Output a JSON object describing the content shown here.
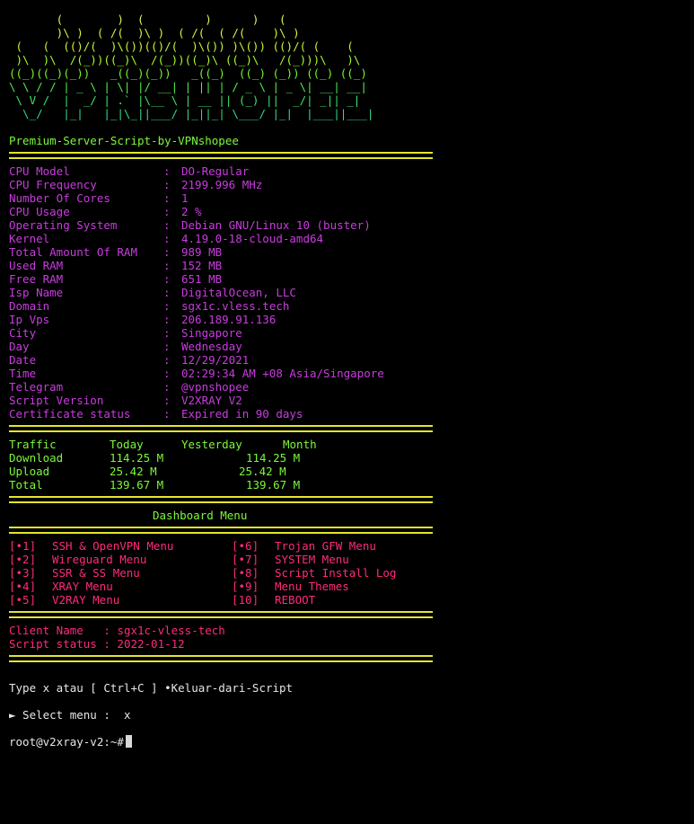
{
  "banner": {
    "ascii_lines": [
      "       (        )  (         )      )   (",
      "       )\\ )  ( /(  )\\ )  ( /(  ( /(    )\\ )",
      " (   (  (()/(  )\\())(()/(  )\\()) )\\()) (()/( (    (",
      " )\\  )\\  /(_))((_)\\  /(_))((_)\\ ((_)\\   /(_)))\\   )\\",
      "((_)((_)(_))   _((_)(_))   _((_)  ((_) (_)) ((_) ((_)",
      "\\ \\ / / | _ \\ | \\| |/ __| | || | / _ \\ | _ \\| __| __|",
      " \\ V /  |  _/ | .` |\\__ \\ | __ || (_) ||  _/| _|| _|",
      "  \\_/   |_|   |_|\\_||___/ |_||_| \\___/ |_|  |___||___|"
    ],
    "title": "Premium-Server-Script-by-VPNshopee"
  },
  "sysinfo": [
    {
      "label": "CPU Model",
      "value": "DO-Regular"
    },
    {
      "label": "CPU Frequency",
      "value": "2199.996 MHz"
    },
    {
      "label": "Number Of Cores",
      "value": "1"
    },
    {
      "label": "CPU Usage",
      "value": "2 %"
    },
    {
      "label": "Operating System",
      "value": "Debian GNU/Linux 10 (buster)"
    },
    {
      "label": "Kernel",
      "value": "4.19.0-18-cloud-amd64"
    },
    {
      "label": "Total Amount Of RAM",
      "value": "989 MB"
    },
    {
      "label": "Used RAM",
      "value": "152 MB"
    },
    {
      "label": "Free RAM",
      "value": "651 MB"
    },
    {
      "label": "Isp Name",
      "value": "DigitalOcean, LLC"
    },
    {
      "label": "Domain",
      "value": "sgx1c.vless.tech"
    },
    {
      "label": "Ip Vps",
      "value": "206.189.91.136"
    },
    {
      "label": "City",
      "value": "Singapore"
    },
    {
      "label": "Day",
      "value": "Wednesday"
    },
    {
      "label": "Date",
      "value": "12/29/2021"
    },
    {
      "label": "Time",
      "value": "02:29:34 AM +08 Asia/Singapore"
    },
    {
      "label": "Telegram",
      "value": "@vpnshopee"
    },
    {
      "label": "Script Version",
      "value": "V2XRAY V2"
    },
    {
      "label": "Certificate status",
      "value": "Expired in 90 days"
    }
  ],
  "sep_char": ":",
  "traffic": {
    "headers": [
      "Traffic",
      "Today",
      "Yesterday",
      "Month"
    ],
    "rows": [
      {
        "name": "Download",
        "today": "114.25 M",
        "yesterday": "",
        "month": "114.25 M"
      },
      {
        "name": "Upload",
        "today": "25.42 M",
        "yesterday": "",
        "month": "25.42 M"
      },
      {
        "name": "Total",
        "today": "139.67 M",
        "yesterday": "",
        "month": "139.67 M"
      }
    ]
  },
  "dashboard": {
    "title": "Dashboard Menu",
    "items": [
      {
        "num": "[•1]",
        "label": "SSH & OpenVPN Menu"
      },
      {
        "num": "[•6]",
        "label": "Trojan GFW Menu"
      },
      {
        "num": "[•2]",
        "label": "Wireguard Menu"
      },
      {
        "num": "[•7]",
        "label": "SYSTEM Menu"
      },
      {
        "num": "[•3]",
        "label": "SSR & SS Menu"
      },
      {
        "num": "[•8]",
        "label": "Script Install Log"
      },
      {
        "num": "[•4]",
        "label": "XRAY Menu"
      },
      {
        "num": "[•9]",
        "label": "Menu Themes"
      },
      {
        "num": "[•5]",
        "label": "V2RAY Menu"
      },
      {
        "num": "[10]",
        "label": "REBOOT"
      }
    ]
  },
  "client": {
    "name_label": "Client Name   :",
    "name_value": "sgx1c-vless-tech",
    "status_label": "Script status :",
    "status_value": "2022-01-12"
  },
  "footer": {
    "hint": "Type x atau [ Ctrl+C ] •Keluar-dari-Script",
    "select_prompt": "► Select menu :",
    "select_value": "x",
    "shell_prompt": "root@v2xray-v2:~#"
  },
  "colors": {
    "background": "#000000",
    "label_purple": "#c93cdf",
    "menu_pink": "#ff2a7c",
    "divider_yellow": "#e3e62a",
    "title_green": "#7cf83a"
  }
}
